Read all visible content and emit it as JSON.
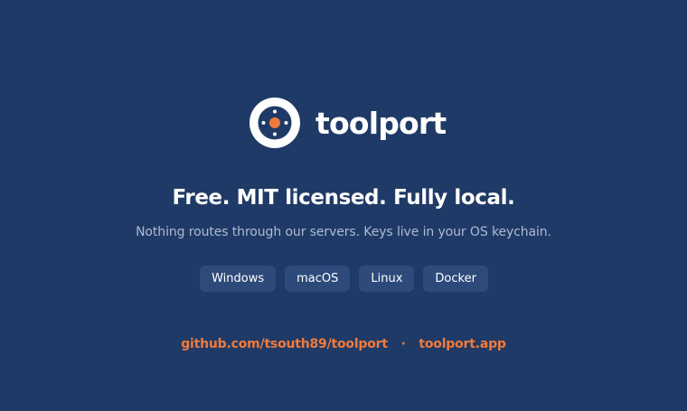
{
  "brand": {
    "name": "toolport",
    "logo_icon": "target-ring-icon",
    "colors": {
      "ring": "#ffffff",
      "core": "#f07a3c",
      "background": "#1f3a66"
    }
  },
  "headline": "Free. MIT licensed. Fully local.",
  "subline": "Nothing routes through our servers. Keys live in your OS keychain.",
  "platforms": [
    {
      "label": "Windows"
    },
    {
      "label": "macOS"
    },
    {
      "label": "Linux"
    },
    {
      "label": "Docker"
    }
  ],
  "links": {
    "repo": "github.com/tsouth89/toolport",
    "separator": "·",
    "site": "toolport.app"
  }
}
